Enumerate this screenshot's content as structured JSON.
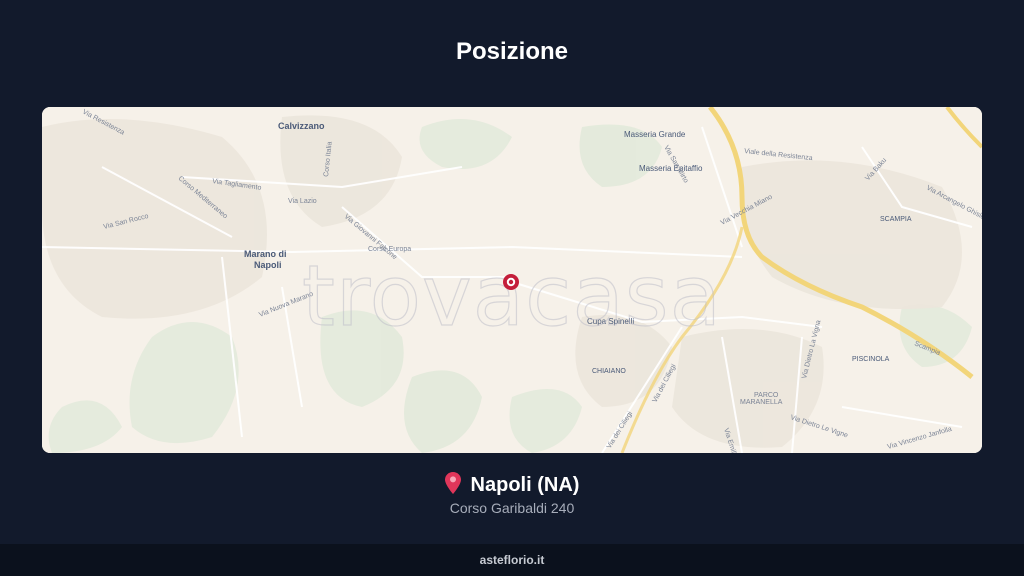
{
  "header": {
    "title": "Posizione"
  },
  "map": {
    "watermark": "trovacasa",
    "places": {
      "calvizzano": "Calvizzano",
      "masseria_grande": "Masseria Grande",
      "masseria_epitaffio": "Masseria Epitaffio",
      "marano_line1": "Marano di",
      "marano_line2": "Napoli",
      "cupa_spinelli": "Cupa Spinelli",
      "chiaiano": "CHIAIANO",
      "scampia": "SCAMPIA",
      "piscinola": "PISCINOLA",
      "parco_line1": "PARCO",
      "parco_line2": "MARANELLA"
    },
    "roads": {
      "via_resistenza": "Via Resistenza",
      "corso_mediterraneo": "Corso Mediterraneo",
      "via_taglamento": "Via Tagliamento",
      "via_lazio": "Via Lazio",
      "via_san_rocco": "Via San Rocco",
      "via_giovanni_falcone": "Via Giovanni Falcone",
      "corso_europa": "Corso Europa",
      "via_nuova_marano": "Via Nuova Marano",
      "corso_italia": "Corso Italia",
      "via_san_mirto": "Via San Mirto",
      "viale_resistenza": "Viale della Resistenza",
      "via_vecchia_miano": "Via Vecchia Miano",
      "via_baku": "Via Baku",
      "via_arcangelo_ghisleri": "Via Arcangelo Ghisleri",
      "via_dei_ciliegi_1": "Via dei Ciliegi",
      "via_dei_ciliegi_2": "Via dei Ciliegi",
      "via_emilio": "Via Emilio",
      "via_dietro_vigne_1": "Via Dietro La Vigna",
      "via_dietro_vigne_2": "Via Dietro Le Vigne",
      "via_vincenzo_janfolla": "Via Vincenzo Janfolla",
      "scampia_road": "Scampia"
    }
  },
  "location": {
    "city": "Napoli (NA)",
    "address": "Corso Garibaldi 240"
  },
  "footer": {
    "brand": "asteflorio.it"
  },
  "colors": {
    "background": "#121a2c",
    "pin": "#c41e3a",
    "motorway": "#f2d57a"
  }
}
